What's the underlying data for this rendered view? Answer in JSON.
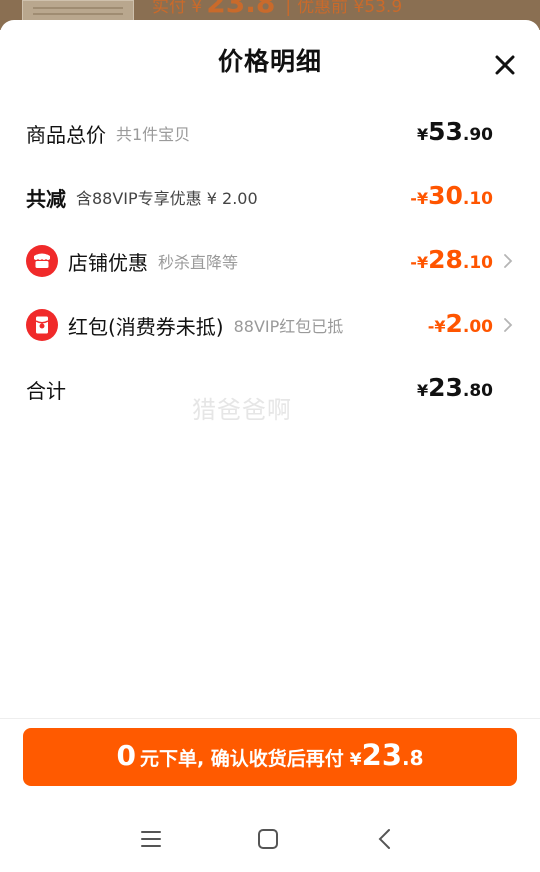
{
  "backdrop": {
    "prefix": "实付 ¥",
    "value": "23.8",
    "separator": "|",
    "before_label": "优惠前 ¥53.9"
  },
  "sheet": {
    "title": "价格明细"
  },
  "rows": {
    "total": {
      "label": "商品总价",
      "note": "共1件宝贝",
      "symbol": "¥",
      "int": "53",
      "dec": ".90"
    },
    "reduction": {
      "label": "共减",
      "note": "含88VIP专享优惠 ¥ 2.00",
      "symbol": "-¥",
      "int": "30",
      "dec": ".10"
    },
    "store": {
      "label": "店铺优惠",
      "note": "秒杀直降等",
      "symbol": "-¥",
      "int": "28",
      "dec": ".10"
    },
    "redpacket": {
      "label": "红包(消费券未抵)",
      "note": "88VIP红包已抵",
      "symbol": "-¥",
      "int": "2",
      "dec": ".00"
    },
    "sum": {
      "label": "合计",
      "symbol": "¥",
      "int": "23",
      "dec": ".80"
    }
  },
  "watermark": "猎爸爸啊",
  "cta": {
    "zero": "0",
    "text": "元下单, 确认收货后再付",
    "symbol": "¥",
    "int": "23",
    "dec": ".8"
  },
  "colors": {
    "accent": "#ff5500",
    "cta_bg": "#ff5a00",
    "icon_red": "#f02a2a"
  },
  "icons": {
    "close": "close-icon",
    "store": "store-icon",
    "redpacket": "red-packet-icon",
    "chevron": "chevron-right-icon",
    "menu": "menu-icon",
    "home": "home-icon",
    "back": "back-icon"
  }
}
